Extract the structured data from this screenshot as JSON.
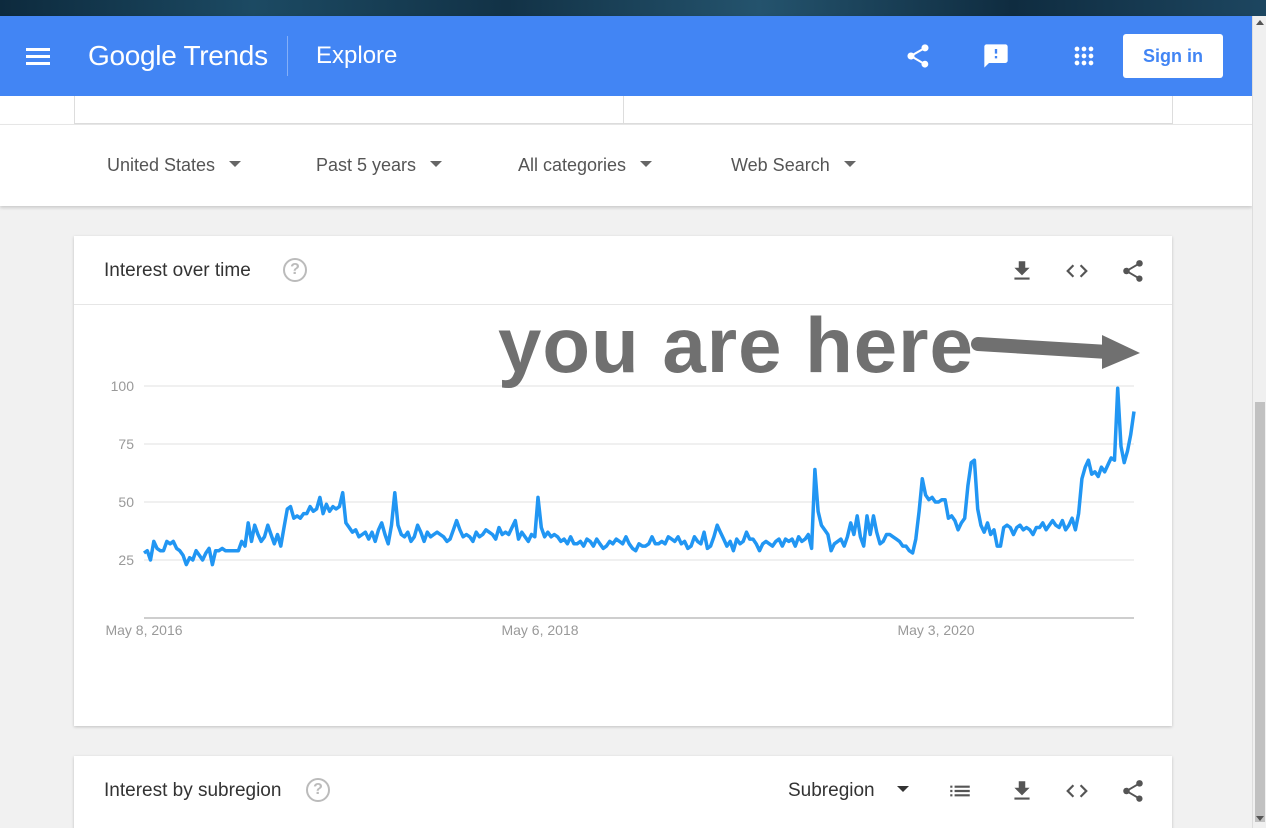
{
  "header": {
    "logo_text": "Google Trends",
    "title": "Explore",
    "sign_in_label": "Sign in",
    "background_color": "#4285f4"
  },
  "filters": [
    {
      "label": "United States"
    },
    {
      "label": "Past 5 years"
    },
    {
      "label": "All categories"
    },
    {
      "label": "Web Search"
    }
  ],
  "interest_over_time": {
    "title": "Interest over time",
    "annotation": "you are here"
  },
  "interest_by_subregion": {
    "title": "Interest by subregion",
    "resolution_select": "Subregion"
  },
  "chart_data": {
    "type": "line",
    "series_color": "#2196f3",
    "ylim": [
      0,
      100
    ],
    "y_ticks": [
      25,
      50,
      75,
      100
    ],
    "x_tick_labels": [
      "May 8, 2016",
      "May 6, 2018",
      "May 3, 2020"
    ],
    "x_start": "2016-05-08",
    "x_end": "2021-05-02",
    "grid": true,
    "values": [
      28,
      29,
      25,
      33,
      30,
      29,
      29,
      33,
      32,
      33,
      30,
      29,
      27,
      23,
      26,
      25,
      29,
      27,
      25,
      28,
      30,
      23,
      29,
      29,
      30,
      29,
      29,
      29,
      29,
      29,
      33,
      31,
      41,
      33,
      40,
      36,
      33,
      35,
      40,
      36,
      32,
      36,
      31,
      39,
      47,
      48,
      43,
      44,
      43,
      45,
      45,
      48,
      46,
      47,
      52,
      45,
      49,
      46,
      48,
      47,
      48,
      54,
      41,
      39,
      37,
      38,
      35,
      36,
      37,
      34,
      37,
      33,
      38,
      41,
      36,
      32,
      40,
      54,
      40,
      36,
      35,
      37,
      33,
      35,
      40,
      37,
      33,
      37,
      35,
      36,
      37,
      36,
      35,
      33,
      34,
      38,
      42,
      38,
      35,
      36,
      35,
      33,
      37,
      35,
      36,
      38,
      37,
      36,
      34,
      39,
      36,
      37,
      36,
      39,
      42,
      34,
      37,
      35,
      33,
      36,
      35,
      52,
      39,
      35,
      37,
      35,
      36,
      35,
      33,
      34,
      32,
      35,
      32,
      32,
      33,
      31,
      34,
      33,
      31,
      34,
      32,
      30,
      31,
      33,
      32,
      34,
      33,
      32,
      35,
      32,
      30,
      29,
      32,
      31,
      31,
      32,
      35,
      32,
      32,
      33,
      32,
      35,
      34,
      33,
      35,
      32,
      33,
      30,
      31,
      35,
      33,
      32,
      37,
      30,
      31,
      35,
      40,
      37,
      34,
      31,
      33,
      29,
      34,
      32,
      33,
      37,
      34,
      34,
      32,
      29,
      32,
      33,
      32,
      31,
      33,
      34,
      31,
      34,
      33,
      34,
      31,
      35,
      33,
      34,
      36,
      30,
      64,
      46,
      40,
      38,
      36,
      29,
      32,
      33,
      34,
      31,
      35,
      41,
      36,
      44,
      35,
      31,
      44,
      36,
      44,
      37,
      32,
      33,
      36,
      36,
      35,
      34,
      33,
      31,
      31,
      29,
      28,
      34,
      46,
      60,
      53,
      51,
      52,
      50,
      50,
      51,
      51,
      43,
      44,
      42,
      38,
      41,
      43,
      57,
      67,
      68,
      47,
      40,
      37,
      41,
      36,
      38,
      31,
      31,
      39,
      40,
      39,
      36,
      39,
      40,
      38,
      39,
      38,
      36,
      39,
      39,
      41,
      38,
      40,
      42,
      40,
      39,
      42,
      38,
      40,
      43,
      38,
      45,
      60,
      65,
      68,
      62,
      63,
      61,
      65,
      63,
      66,
      69,
      68,
      99,
      74,
      67,
      72,
      79,
      89
    ]
  }
}
